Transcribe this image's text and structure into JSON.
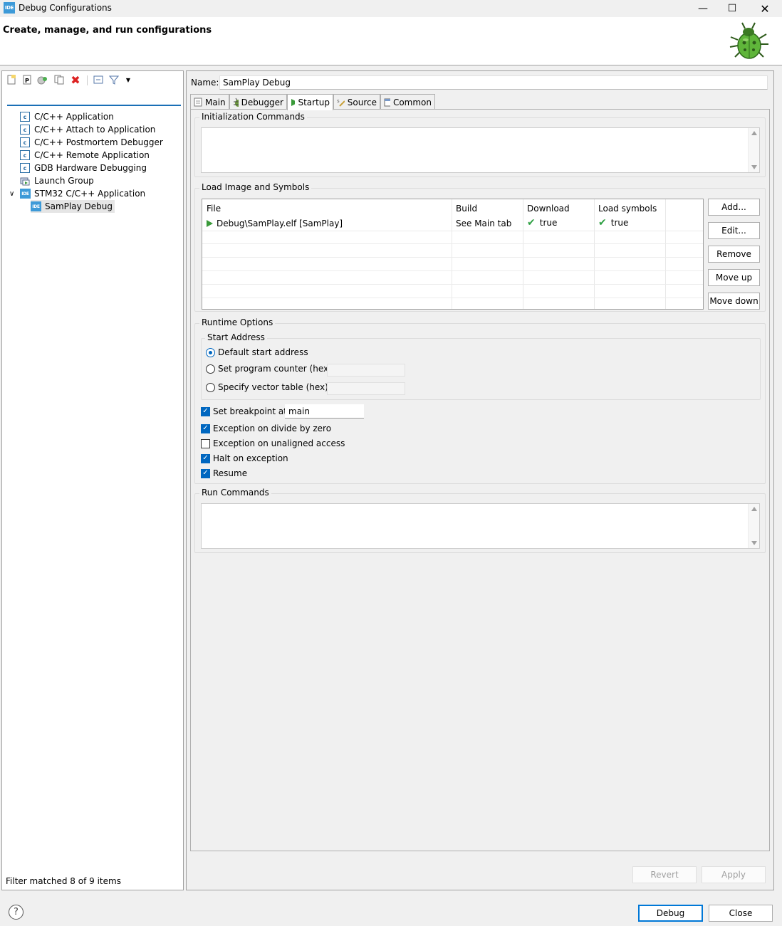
{
  "window": {
    "title": "Debug Configurations",
    "icon_text": "IDE",
    "header_text": "Create, manage, and run configurations"
  },
  "left": {
    "filter_placeholder": "",
    "tree": [
      {
        "label": "C/C++ Application",
        "icon": "c-icon"
      },
      {
        "label": "C/C++ Attach to Application",
        "icon": "c-icon"
      },
      {
        "label": "C/C++ Postmortem Debugger",
        "icon": "c-icon"
      },
      {
        "label": "C/C++ Remote Application",
        "icon": "c-icon"
      },
      {
        "label": "GDB Hardware Debugging",
        "icon": "c-icon"
      },
      {
        "label": "Launch Group",
        "icon": "launch-group-icon"
      },
      {
        "label": "STM32 C/C++ Application",
        "icon": "ide-icon",
        "expanded": true
      },
      {
        "label": "SamPlay Debug",
        "icon": "ide-icon",
        "selected": true
      }
    ],
    "status": "Filter matched 8 of 9 items"
  },
  "config": {
    "name_label": "Name:",
    "name_value": "SamPlay Debug",
    "tabs": [
      "Main",
      "Debugger",
      "Startup",
      "Source",
      "Common"
    ],
    "active_tab": "Startup"
  },
  "startup": {
    "init_commands_title": "Initialization Commands",
    "load_title": "Load Image and Symbols",
    "table_headers": [
      "File",
      "Build",
      "Download",
      "Load symbols"
    ],
    "rows": [
      {
        "file": "Debug\\SamPlay.elf [SamPlay]",
        "build": "See Main tab",
        "download": "true",
        "load_symbols": "true"
      }
    ],
    "buttons": [
      "Add...",
      "Edit...",
      "Remove",
      "Move up",
      "Move down"
    ],
    "runtime_title": "Runtime Options",
    "start_address_title": "Start Address",
    "radio_default": "Default start address",
    "radio_pc": "Set program counter (hex):",
    "radio_vector": "Specify vector table (hex):",
    "breakpoint_label": "Set breakpoint at:",
    "breakpoint_value": "main",
    "exc_divide": "Exception on divide by zero",
    "exc_unaligned": "Exception on unaligned access",
    "halt_exception": "Halt on exception",
    "resume": "Resume",
    "run_commands_title": "Run Commands"
  },
  "actions": {
    "revert": "Revert",
    "apply": "Apply",
    "debug": "Debug",
    "close": "Close",
    "help": "?"
  },
  "colors": {
    "accent": "#0078d7",
    "check": "#0067c0",
    "selection": "#e5e5e5"
  }
}
